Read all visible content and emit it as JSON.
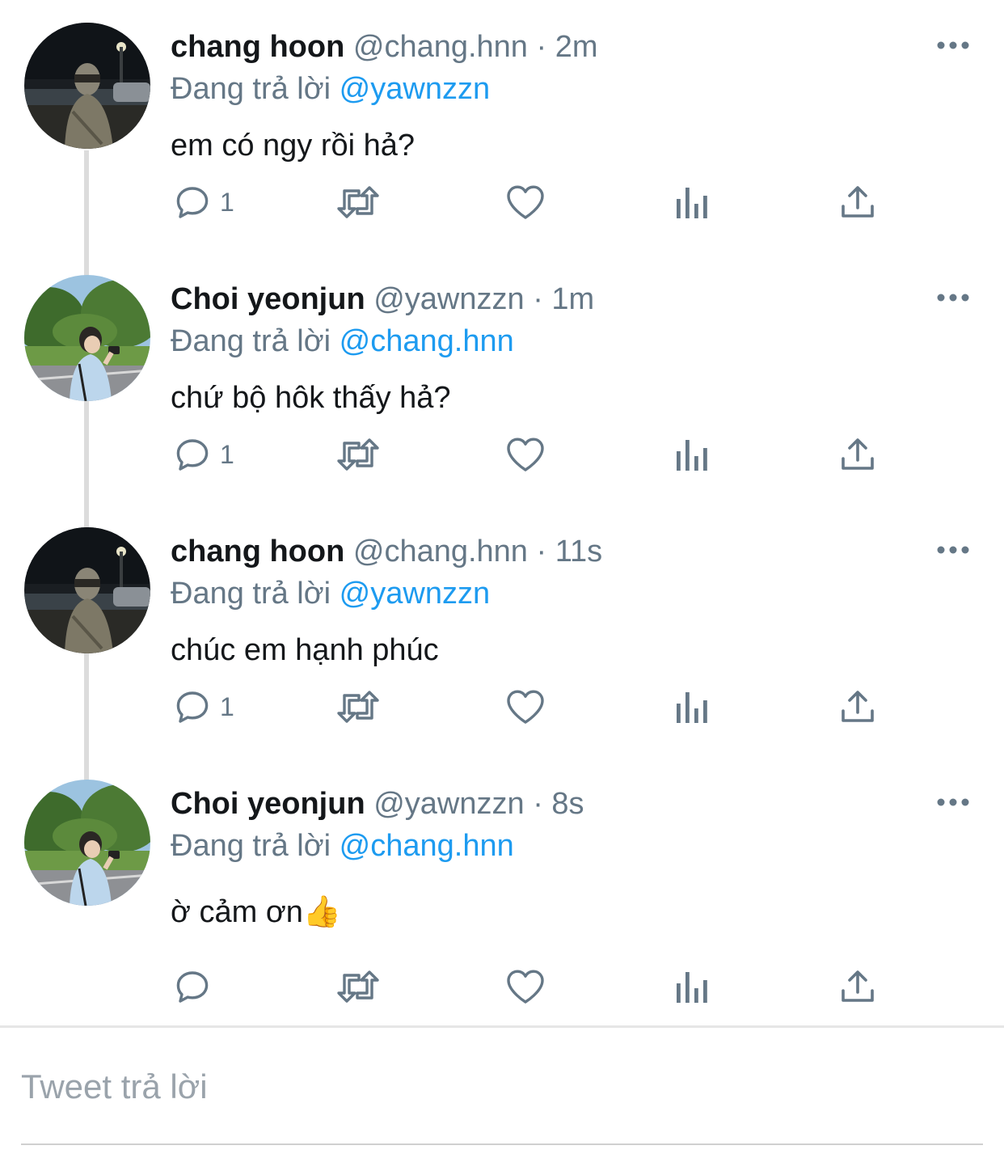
{
  "tweets": [
    {
      "name": "chang hoon",
      "handle": "@chang.hnn",
      "separator": "·",
      "time": "2m",
      "replying_label": "Đang trả lời",
      "replying_to": "@yawnzzn",
      "text": "em có ngy rồi hả?",
      "reply_count": "1",
      "avatar": "night-street-avatar"
    },
    {
      "name": "Choi yeonjun",
      "handle": "@yawnzzn",
      "separator": "·",
      "time": "1m",
      "replying_label": "Đang trả lời",
      "replying_to": "@chang.hnn",
      "text": "chứ bộ hôk thấy hả?",
      "reply_count": "1",
      "avatar": "park-camera-avatar"
    },
    {
      "name": "chang hoon",
      "handle": "@chang.hnn",
      "separator": "·",
      "time": "11s",
      "replying_label": "Đang trả lời",
      "replying_to": "@yawnzzn",
      "text": "chúc em hạnh phúc",
      "reply_count": "1",
      "avatar": "night-street-avatar"
    },
    {
      "name": "Choi yeonjun",
      "handle": "@yawnzzn",
      "separator": "·",
      "time": "8s",
      "replying_label": "Đang trả lời",
      "replying_to": "@chang.hnn",
      "text": "ờ cảm ơn👍",
      "reply_count": "",
      "avatar": "park-camera-avatar"
    }
  ],
  "compose": {
    "placeholder": "Tweet trả lời"
  },
  "colors": {
    "link": "#1d9bf0",
    "muted": "#657786",
    "icon": "#657786",
    "thread_line": "#dcdcdc"
  },
  "icons": {
    "reply": "reply-icon",
    "retweet": "retweet-icon",
    "like": "heart-icon",
    "analytics": "analytics-icon",
    "share": "share-icon",
    "more": "more-icon"
  }
}
